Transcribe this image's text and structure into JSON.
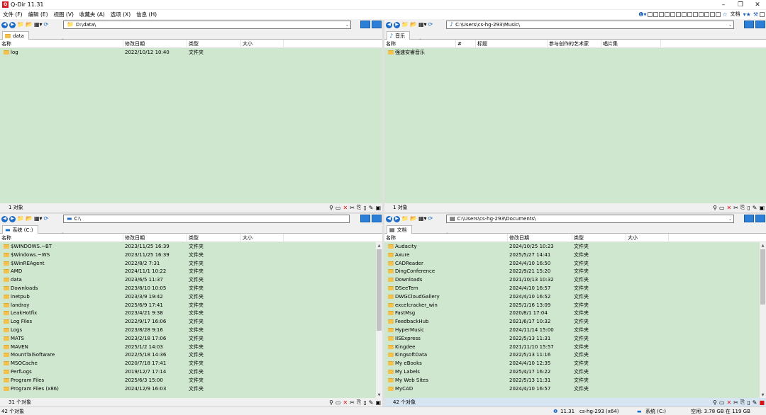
{
  "window": {
    "title": "Q-Dir 11.31",
    "min": "–",
    "max": "❐",
    "close": "✕"
  },
  "menu": {
    "items": [
      "文件 (F)",
      "编辑 (E)",
      "视图 (V)",
      "收藏夹 (A)",
      "选项 (X)",
      "信息 (H)"
    ],
    "right_text": "文档"
  },
  "panes": [
    {
      "path": "D:\\data\\",
      "tab": "data",
      "columns": [
        "名称",
        "修改日期",
        "类型",
        "大小"
      ],
      "rows": [
        [
          "log",
          "2022/10/12 10:40",
          "文件夹",
          ""
        ]
      ],
      "status": "1 对象"
    },
    {
      "path": "C:\\Users\\cs-hg-293\\Music\\",
      "tab": "音乐",
      "columns": [
        "名称",
        "#",
        "标题",
        "参与创作的艺术家",
        "唱片集"
      ],
      "rows": [
        [
          "强速安睿音乐",
          "",
          "",
          "",
          ""
        ]
      ],
      "status": "1 对象"
    },
    {
      "path": "C:\\",
      "tab": "系统 (C:)",
      "columns": [
        "名称",
        "修改日期",
        "类型",
        "大小"
      ],
      "rows": [
        [
          "$WINDOWS.~BT",
          "2023/11/25 16:39",
          "文件夹",
          ""
        ],
        [
          "$Windows.~WS",
          "2023/11/25 16:39",
          "文件夹",
          ""
        ],
        [
          "$WinREAgent",
          "2022/8/2 7:31",
          "文件夹",
          ""
        ],
        [
          "AMD",
          "2024/11/1 10:22",
          "文件夹",
          ""
        ],
        [
          "data",
          "2023/6/5 11:37",
          "文件夹",
          ""
        ],
        [
          "Downloads",
          "2023/8/10 10:05",
          "文件夹",
          ""
        ],
        [
          "inetpub",
          "2023/3/9 19:42",
          "文件夹",
          ""
        ],
        [
          "landray",
          "2025/6/9 17:41",
          "文件夹",
          ""
        ],
        [
          "LeakHotfix",
          "2023/4/21 9:38",
          "文件夹",
          ""
        ],
        [
          "Log Files",
          "2022/9/17 16:06",
          "文件夹",
          ""
        ],
        [
          "Logs",
          "2023/8/28 9:16",
          "文件夹",
          ""
        ],
        [
          "MATS",
          "2023/2/18 17:06",
          "文件夹",
          ""
        ],
        [
          "MAVEN",
          "2025/1/2 14:03",
          "文件夹",
          ""
        ],
        [
          "MountTaiSoftware",
          "2022/5/18 14:36",
          "文件夹",
          ""
        ],
        [
          "MSOCache",
          "2020/7/18 17:41",
          "文件夹",
          ""
        ],
        [
          "PerfLogs",
          "2019/12/7 17:14",
          "文件夹",
          ""
        ],
        [
          "Program Files",
          "2025/6/3 15:00",
          "文件夹",
          ""
        ],
        [
          "Program Files (x86)",
          "2024/12/9 16:03",
          "文件夹",
          ""
        ]
      ],
      "status": "31 个对象"
    },
    {
      "path": "C:\\Users\\cs-hg-293\\Documents\\",
      "tab": "文档",
      "columns": [
        "名称",
        "修改日期",
        "类型",
        "大小"
      ],
      "rows": [
        [
          "Audacity",
          "2024/10/25 10:23",
          "文件夹",
          ""
        ],
        [
          "Axure",
          "2025/5/27 14:41",
          "文件夹",
          ""
        ],
        [
          "CADReader",
          "2024/4/10 16:50",
          "文件夹",
          ""
        ],
        [
          "DingConference",
          "2022/9/21 15:20",
          "文件夹",
          ""
        ],
        [
          "Downloads",
          "2021/10/13 10:32",
          "文件夹",
          ""
        ],
        [
          "DSeeTem",
          "2024/4/10 16:57",
          "文件夹",
          ""
        ],
        [
          "DWGCloudGallery",
          "2024/4/10 16:52",
          "文件夹",
          ""
        ],
        [
          "excelcracker_win",
          "2025/1/16 13:09",
          "文件夹",
          ""
        ],
        [
          "FastMsg",
          "2020/8/1 17:04",
          "文件夹",
          ""
        ],
        [
          "FeedbackHub",
          "2021/6/17 10:32",
          "文件夹",
          ""
        ],
        [
          "HyperMusic",
          "2024/11/14 15:00",
          "文件夹",
          ""
        ],
        [
          "IISExpress",
          "2022/5/13 11:31",
          "文件夹",
          ""
        ],
        [
          "Kingdee",
          "2021/11/10 15:57",
          "文件夹",
          ""
        ],
        [
          "KingsoftData",
          "2022/5/13 11:16",
          "文件夹",
          ""
        ],
        [
          "My eBooks",
          "2024/4/10 12:35",
          "文件夹",
          ""
        ],
        [
          "My Labels",
          "2025/4/17 16:22",
          "文件夹",
          ""
        ],
        [
          "My Web Sites",
          "2022/5/13 11:31",
          "文件夹",
          ""
        ],
        [
          "MyCAD",
          "2024/4/10 16:57",
          "文件夹",
          ""
        ]
      ],
      "status": "42 个对象"
    }
  ],
  "bottom_status": {
    "count": "42 个对象",
    "version": "11.31",
    "computer": "cs-hg-293 (x64)",
    "drive": "系统 (C:)",
    "free": "空闲: 3.78 GB 在 119 GB"
  }
}
